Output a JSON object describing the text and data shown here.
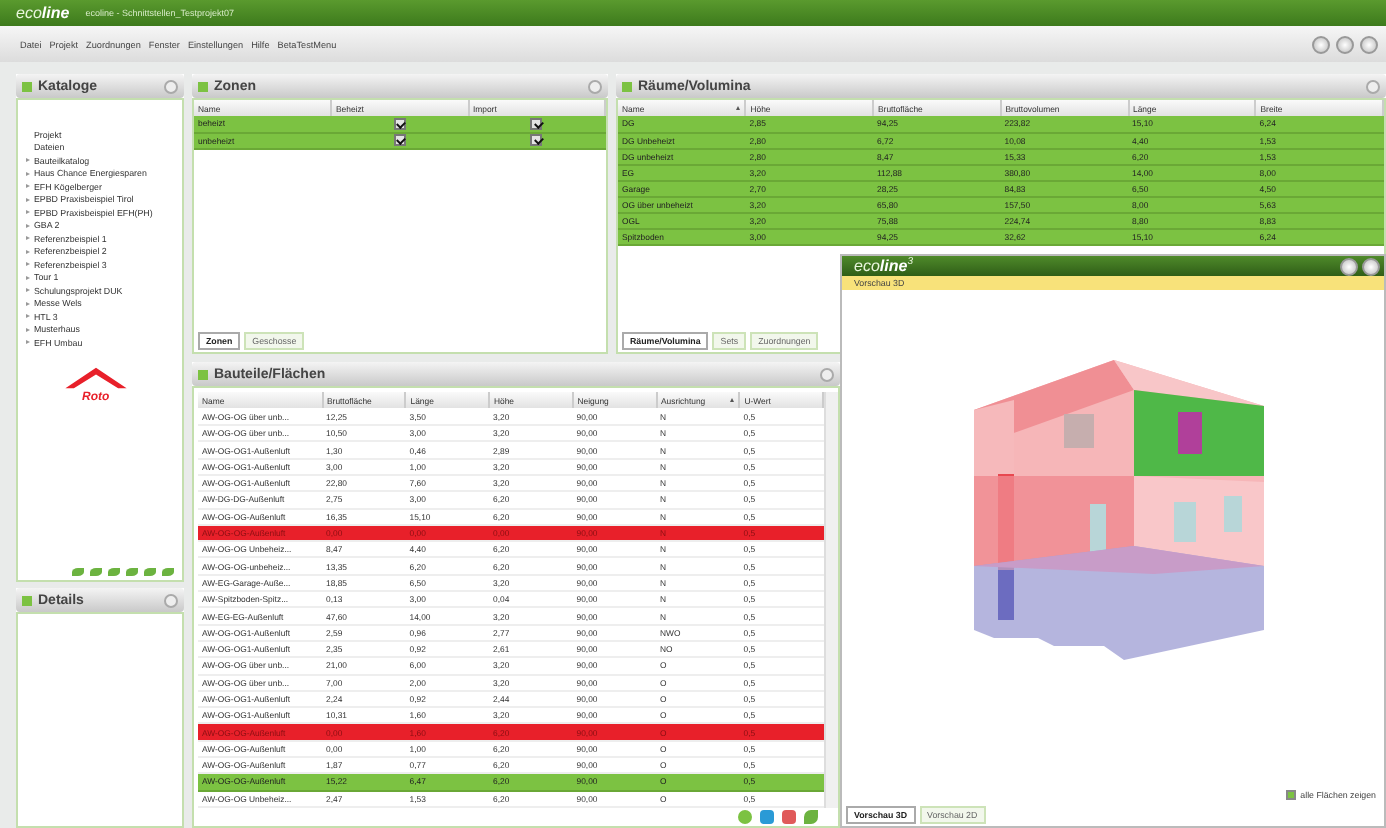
{
  "window": {
    "logo": "eco",
    "logo_bold": "line",
    "title": "ecoline - Schnittstellen_Testprojekt07"
  },
  "menu": [
    "Datei",
    "Projekt",
    "Zuordnungen",
    "Fenster",
    "Einstellungen",
    "Hilfe",
    "BetaTestMenu"
  ],
  "catalog": {
    "title": "Kataloge",
    "logo_text": "Roto",
    "items": [
      {
        "label": "Projekt",
        "expandable": false
      },
      {
        "label": "Dateien",
        "expandable": false
      },
      {
        "label": "Bauteilkatalog",
        "expandable": true
      },
      {
        "label": "Haus Chance Energiesparen",
        "expandable": true
      },
      {
        "label": "EFH Kögelberger",
        "expandable": true
      },
      {
        "label": "EPBD Praxisbeispiel Tirol",
        "expandable": true
      },
      {
        "label": "EPBD Praxisbeispiel EFH(PH)",
        "expandable": true
      },
      {
        "label": "GBA 2",
        "expandable": true
      },
      {
        "label": "Referenzbeispiel 1",
        "expandable": true
      },
      {
        "label": "Referenzbeispiel 2",
        "expandable": true
      },
      {
        "label": "Referenzbeispiel 3",
        "expandable": true
      },
      {
        "label": "Tour 1",
        "expandable": true
      },
      {
        "label": "Schulungsprojekt DUK",
        "expandable": true
      },
      {
        "label": "Messe Wels",
        "expandable": true
      },
      {
        "label": "HTL 3",
        "expandable": true
      },
      {
        "label": "Musterhaus",
        "expandable": true
      },
      {
        "label": "EFH Umbau",
        "expandable": true
      }
    ]
  },
  "details": {
    "title": "Details"
  },
  "zones": {
    "title": "Zonen",
    "columns": [
      {
        "label": "Name",
        "sorted": false
      },
      {
        "label": "Beheizt",
        "sorted": false
      },
      {
        "label": "Import",
        "sorted": false
      }
    ],
    "rows": [
      {
        "name": "beheizt",
        "heated": true,
        "imported": true,
        "selected": true
      },
      {
        "name": "unbeheizt",
        "heated": true,
        "imported": true,
        "selected": true
      }
    ],
    "tabs": [
      {
        "label": "Zonen",
        "selected": true
      },
      {
        "label": "Geschosse",
        "selected": false
      }
    ]
  },
  "rooms": {
    "title": "Räume/Volumina",
    "columns": [
      {
        "label": "Name",
        "sorted": true
      },
      {
        "label": "Höhe",
        "sorted": false
      },
      {
        "label": "Bruttofläche",
        "sorted": false
      },
      {
        "label": "Bruttovolumen",
        "sorted": false
      },
      {
        "label": "Länge",
        "sorted": false
      },
      {
        "label": "Breite",
        "sorted": false
      }
    ],
    "rows": [
      {
        "cells": [
          "DG",
          "2,85",
          "94,25",
          "223,82",
          "15,10",
          "6,24"
        ],
        "selected": true
      },
      {
        "cells": [
          "DG Unbeheizt",
          "2,80",
          "6,72",
          "10,08",
          "4,40",
          "1,53"
        ],
        "selected": true
      },
      {
        "cells": [
          "DG unbeheizt",
          "2,80",
          "8,47",
          "15,33",
          "6,20",
          "1,53"
        ],
        "selected": true
      },
      {
        "cells": [
          "EG",
          "3,20",
          "112,88",
          "380,80",
          "14,00",
          "8,00"
        ],
        "selected": true
      },
      {
        "cells": [
          "Garage",
          "2,70",
          "28,25",
          "84,83",
          "6,50",
          "4,50"
        ],
        "selected": true
      },
      {
        "cells": [
          "OG über unbeheizt",
          "3,20",
          "65,80",
          "157,50",
          "8,00",
          "5,63"
        ],
        "selected": true
      },
      {
        "cells": [
          "OGL",
          "3,20",
          "75,88",
          "224,74",
          "8,80",
          "8,83"
        ],
        "selected": true
      },
      {
        "cells": [
          "Spitzboden",
          "3,00",
          "94,25",
          "32,62",
          "15,10",
          "6,24"
        ],
        "selected": true
      }
    ],
    "tabs": [
      {
        "label": "Räume/Volumina",
        "selected": true
      },
      {
        "label": "Sets",
        "selected": false
      },
      {
        "label": "Zuordnungen",
        "selected": false
      }
    ]
  },
  "surfaces": {
    "title": "Bauteile/Flächen",
    "columns": [
      {
        "label": "Name",
        "sorted": false
      },
      {
        "label": "Bruttofläche",
        "sorted": false
      },
      {
        "label": "Länge",
        "sorted": false
      },
      {
        "label": "Höhe",
        "sorted": false
      },
      {
        "label": "Neigung",
        "sorted": false
      },
      {
        "label": "Ausrichtung",
        "sorted": true
      },
      {
        "label": "U-Wert",
        "sorted": false
      }
    ],
    "rows": [
      {
        "cells": [
          "AW-OG-OG über unb...",
          "12,25",
          "3,50",
          "3,20",
          "90,00",
          "N",
          "0,5"
        ],
        "selected": false,
        "error": false
      },
      {
        "cells": [
          "AW-OG-OG über unb...",
          "10,50",
          "3,00",
          "3,20",
          "90,00",
          "N",
          "0,5"
        ],
        "selected": false,
        "error": false
      },
      {
        "cells": [
          "AW-OG-OG1-Außenluft",
          "1,30",
          "0,46",
          "2,89",
          "90,00",
          "N",
          "0,5"
        ],
        "selected": false,
        "error": false
      },
      {
        "cells": [
          "AW-OG-OG1-Außenluft",
          "3,00",
          "1,00",
          "3,20",
          "90,00",
          "N",
          "0,5"
        ],
        "selected": false,
        "error": false
      },
      {
        "cells": [
          "AW-OG-OG1-Außenluft",
          "22,80",
          "7,60",
          "3,20",
          "90,00",
          "N",
          "0,5"
        ],
        "selected": false,
        "error": false
      },
      {
        "cells": [
          "AW-DG-DG-Außenluft",
          "2,75",
          "3,00",
          "6,20",
          "90,00",
          "N",
          "0,5"
        ],
        "selected": false,
        "error": false
      },
      {
        "cells": [
          "AW-OG-OG-Außenluft",
          "16,35",
          "15,10",
          "6,20",
          "90,00",
          "N",
          "0,5"
        ],
        "selected": false,
        "error": false
      },
      {
        "cells": [
          "AW-OG-OG-Außenluft",
          "0,00",
          "0,00",
          "0,00",
          "90,00",
          "N",
          "0,5"
        ],
        "selected": false,
        "error": true
      },
      {
        "cells": [
          "AW-OG-OG Unbeheiz...",
          "8,47",
          "4,40",
          "6,20",
          "90,00",
          "N",
          "0,5"
        ],
        "selected": false,
        "error": false
      },
      {
        "cells": [
          "AW-OG-OG-unbeheiz...",
          "13,35",
          "6,20",
          "6,20",
          "90,00",
          "N",
          "0,5"
        ],
        "selected": false,
        "error": false
      },
      {
        "cells": [
          "AW-EG-Garage-Auße...",
          "18,85",
          "6,50",
          "3,20",
          "90,00",
          "N",
          "0,5"
        ],
        "selected": false,
        "error": false
      },
      {
        "cells": [
          "AW-Spitzboden-Spitz...",
          "0,13",
          "3,00",
          "0,04",
          "90,00",
          "N",
          "0,5"
        ],
        "selected": false,
        "error": false
      },
      {
        "cells": [
          "AW-EG-EG-Außenluft",
          "47,60",
          "14,00",
          "3,20",
          "90,00",
          "N",
          "0,5"
        ],
        "selected": false,
        "error": false
      },
      {
        "cells": [
          "AW-OG-OG1-Außenluft",
          "2,59",
          "0,96",
          "2,77",
          "90,00",
          "NWO",
          "0,5"
        ],
        "selected": false,
        "error": false
      },
      {
        "cells": [
          "AW-OG-OG1-Außenluft",
          "2,35",
          "0,92",
          "2,61",
          "90,00",
          "NO",
          "0,5"
        ],
        "selected": false,
        "error": false
      },
      {
        "cells": [
          "AW-OG-OG über unb...",
          "21,00",
          "6,00",
          "3,20",
          "90,00",
          "O",
          "0,5"
        ],
        "selected": false,
        "error": false
      },
      {
        "cells": [
          "AW-OG-OG über unb...",
          "7,00",
          "2,00",
          "3,20",
          "90,00",
          "O",
          "0,5"
        ],
        "selected": false,
        "error": false
      },
      {
        "cells": [
          "AW-OG-OG1-Außenluft",
          "2,24",
          "0,92",
          "2,44",
          "90,00",
          "O",
          "0,5"
        ],
        "selected": false,
        "error": false
      },
      {
        "cells": [
          "AW-OG-OG1-Außenluft",
          "10,31",
          "1,60",
          "3,20",
          "90,00",
          "O",
          "0,5"
        ],
        "selected": false,
        "error": false
      },
      {
        "cells": [
          "AW-OG-OG-Außenluft",
          "0,00",
          "1,60",
          "6,20",
          "90,00",
          "O",
          "0,5"
        ],
        "selected": false,
        "error": true
      },
      {
        "cells": [
          "AW-OG-OG-Außenluft",
          "0,00",
          "1,00",
          "6,20",
          "90,00",
          "O",
          "0,5"
        ],
        "selected": false,
        "error": false
      },
      {
        "cells": [
          "AW-OG-OG-Außenluft",
          "1,87",
          "0,77",
          "6,20",
          "90,00",
          "O",
          "0,5"
        ],
        "selected": false,
        "error": false
      },
      {
        "cells": [
          "AW-OG-OG-Außenluft",
          "15,22",
          "6,47",
          "6,20",
          "90,00",
          "O",
          "0,5"
        ],
        "selected": true,
        "error": false
      },
      {
        "cells": [
          "AW-OG-OG Unbeheiz...",
          "2,47",
          "1,53",
          "6,20",
          "90,00",
          "O",
          "0,5"
        ],
        "selected": false,
        "error": false
      }
    ]
  },
  "preview": {
    "logo": "eco",
    "logo_bold": "line",
    "logo_sup": "3",
    "title": "Vorschau 3D",
    "show_all": {
      "label": "alle Flächen zeigen",
      "checked": true
    },
    "tabs": [
      {
        "label": "Vorschau 3D",
        "selected": true
      },
      {
        "label": "Vorschau 2D",
        "selected": false
      }
    ]
  }
}
